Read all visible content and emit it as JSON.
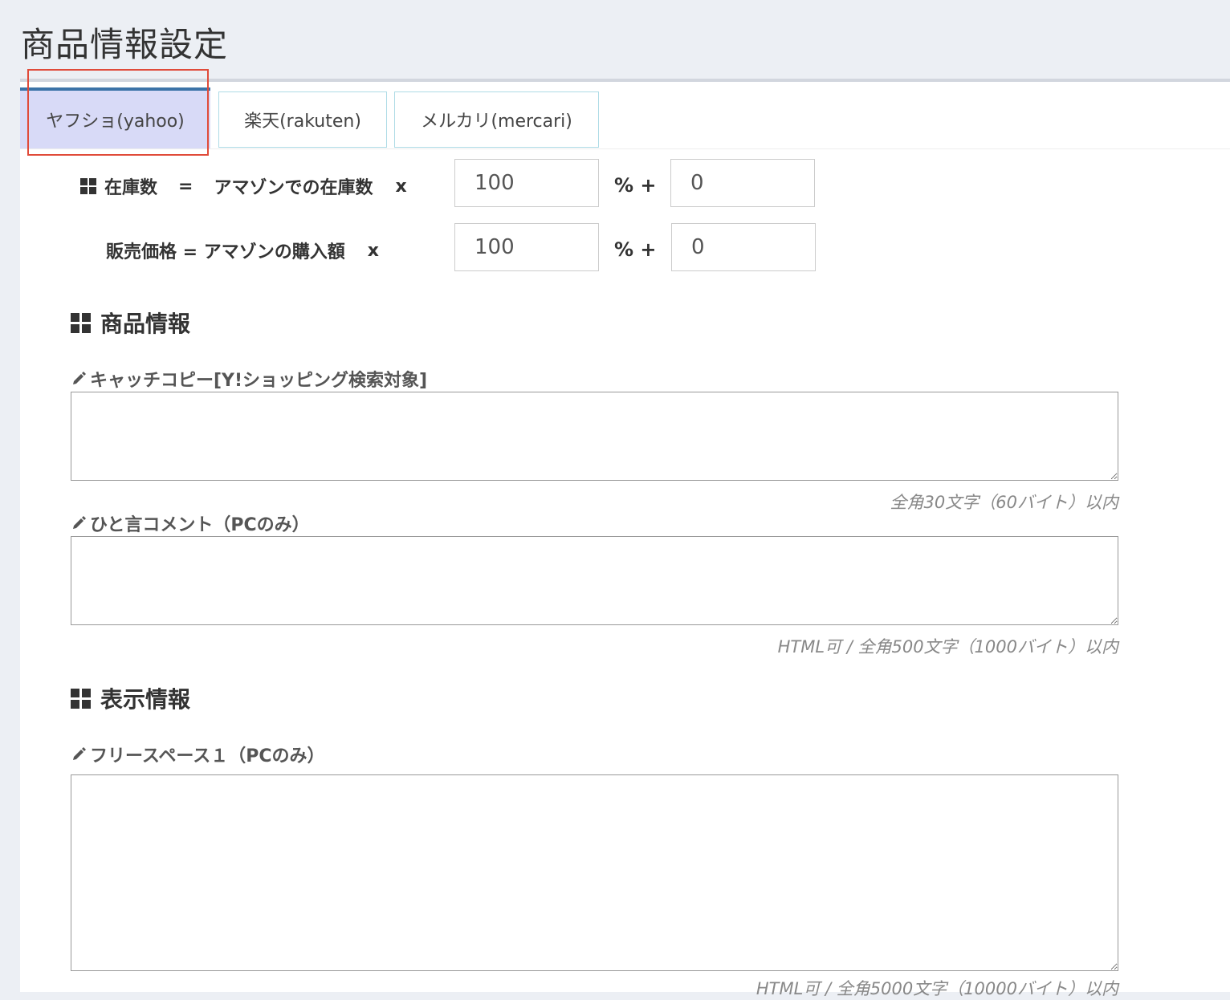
{
  "page": {
    "title": "商品情報設定"
  },
  "tabs": [
    {
      "label": "ヤフショ(yahoo)",
      "active": true
    },
    {
      "label": "楽天(rakuten)",
      "active": false
    },
    {
      "label": "メルカリ(mercari)",
      "active": false
    }
  ],
  "colors": {
    "active_tab_bg": "#d8daf7",
    "active_tab_border": "#3c73a8",
    "highlight": "#e04b3a"
  },
  "stock_formula": {
    "left": "在庫数",
    "equals": "=",
    "right": "アマゾンでの在庫数",
    "times": "x",
    "percent_value": "100",
    "plus_label": "% +",
    "add_value": "0"
  },
  "price_formula": {
    "text": "販売価格 = アマゾンの購入額",
    "times": "x",
    "percent_value": "100",
    "plus_label": "% +",
    "add_value": "0"
  },
  "product_section": {
    "heading": "商品情報",
    "catch_copy": {
      "label": "キャッチコピー[Y!ショッピング検索対象]",
      "value": "",
      "hint": "全角30文字（60バイト）以内"
    },
    "comment": {
      "label": "ひと言コメント（PCのみ）",
      "value": "",
      "hint": "HTML可 / 全角500文字（1000バイト）以内"
    }
  },
  "display_section": {
    "heading": "表示情報",
    "free_space_1": {
      "label": "フリースペース１（PCのみ）",
      "value": "",
      "hint": "HTML可 / 全角5000文字（10000バイト）以内"
    }
  }
}
